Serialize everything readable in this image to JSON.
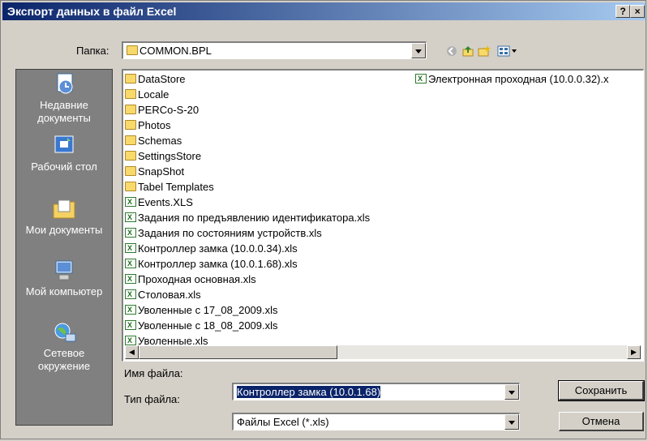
{
  "window": {
    "title": "Экспорт данных в файл Excel",
    "help_label": "?",
    "close_label": "×"
  },
  "lookin": {
    "label": "Папка:",
    "value": "COMMON.BPL"
  },
  "toolbar": {
    "icons": [
      "back-icon",
      "up-folder-icon",
      "new-folder-icon",
      "view-menu-icon"
    ]
  },
  "places": [
    {
      "label": "Недавние документы",
      "icon": "recent-documents-icon"
    },
    {
      "label": "Рабочий стол",
      "icon": "desktop-icon"
    },
    {
      "label": "Мои документы",
      "icon": "my-documents-icon"
    },
    {
      "label": "Мой компьютер",
      "icon": "my-computer-icon"
    },
    {
      "label": "Сетевое окружение",
      "icon": "network-icon"
    }
  ],
  "files": [
    {
      "name": "DataStore",
      "type": "folder"
    },
    {
      "name": "Locale",
      "type": "folder"
    },
    {
      "name": "PERCo-S-20",
      "type": "folder"
    },
    {
      "name": "Photos",
      "type": "folder"
    },
    {
      "name": "Schemas",
      "type": "folder"
    },
    {
      "name": "SettingsStore",
      "type": "folder"
    },
    {
      "name": "SnapShot",
      "type": "folder"
    },
    {
      "name": "Tabel Templates",
      "type": "folder"
    },
    {
      "name": "Events.XLS",
      "type": "xls"
    },
    {
      "name": "Задания по предъявлению идентификатора.xls",
      "type": "xls"
    },
    {
      "name": "Задания по состояниям устройств.xls",
      "type": "xls"
    },
    {
      "name": "Контроллер замка (10.0.0.34).xls",
      "type": "xls"
    },
    {
      "name": "Контроллер замка (10.0.1.68).xls",
      "type": "xls"
    },
    {
      "name": "Проходная основная.xls",
      "type": "xls"
    },
    {
      "name": "Столовая.xls",
      "type": "xls"
    },
    {
      "name": "Уволенные с 17_08_2009.xls",
      "type": "xls"
    },
    {
      "name": "Уволенные с 18_08_2009.xls",
      "type": "xls"
    },
    {
      "name": "Уволенные.xls",
      "type": "xls"
    },
    {
      "name": "Электронная проходная (10.0.0.32).x",
      "type": "xls"
    }
  ],
  "filename": {
    "label": "Имя файла:",
    "value": "Контроллер замка (10.0.1.68)"
  },
  "filetype": {
    "label": "Тип файла:",
    "value": "Файлы Excel (*.xls)"
  },
  "buttons": {
    "save": "Сохранить",
    "cancel": "Отмена"
  }
}
